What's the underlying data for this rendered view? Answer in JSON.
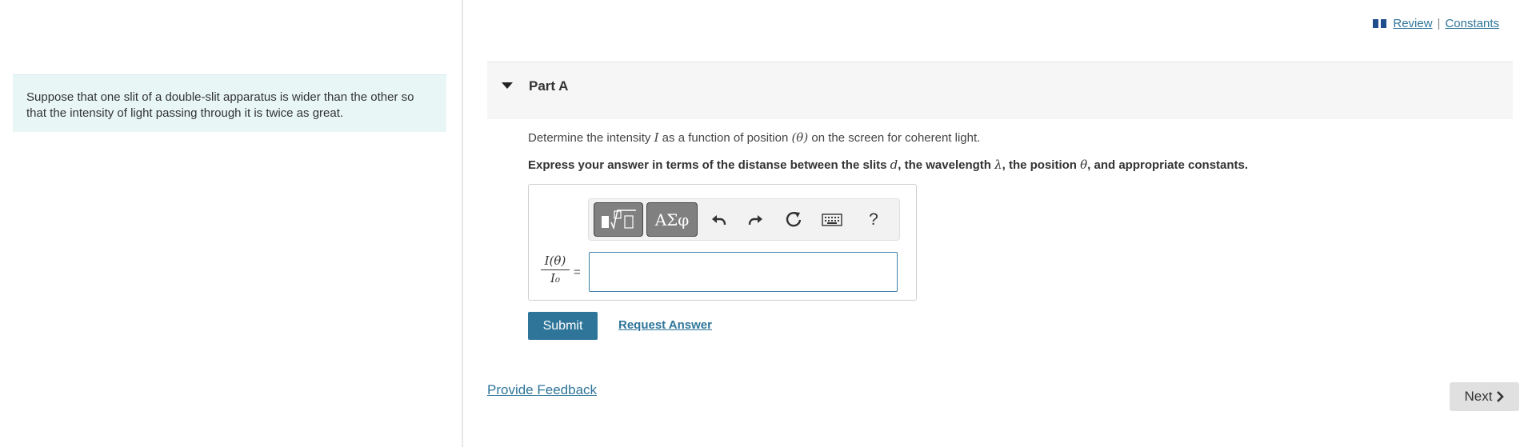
{
  "context": {
    "text": "Suppose that one slit of a double-slit apparatus is wider than the other so that the intensity of light passing through it is twice as great."
  },
  "top_links": {
    "review": "Review",
    "separator": "|",
    "constants": "Constants"
  },
  "part": {
    "title": "Part A",
    "question": {
      "p1": "Determine the intensity ",
      "v1": "I",
      "p2": " as a function of position ",
      "v2": "(θ)",
      "p3": " on the screen for coherent light."
    },
    "instruction": {
      "p1": "Express your answer in terms of the distanse between the slits ",
      "v1": "d",
      "p2": ", the wavelength ",
      "v2": "λ",
      "p3": ", the position ",
      "v3": "θ",
      "p4": ", and appropriate constants."
    }
  },
  "toolbar": {
    "templates_label": "▯√▯",
    "symbols_label": "ΑΣφ",
    "help_label": "?",
    "icons": [
      "templates-icon",
      "greek-symbols-icon",
      "undo-icon",
      "redo-icon",
      "reset-icon",
      "keyboard-icon",
      "help-icon"
    ]
  },
  "answer": {
    "lhs_numerator": "I(θ)",
    "lhs_denominator": "I₀",
    "equals": "=",
    "value": ""
  },
  "buttons": {
    "submit": "Submit",
    "request_answer": "Request Answer",
    "provide_feedback": "Provide Feedback",
    "next": "Next"
  },
  "colors": {
    "link": "#2e7599",
    "submit_bg": "#2e7599",
    "context_bg": "#e8f6f6",
    "toolbar_button_bg": "#808080"
  }
}
